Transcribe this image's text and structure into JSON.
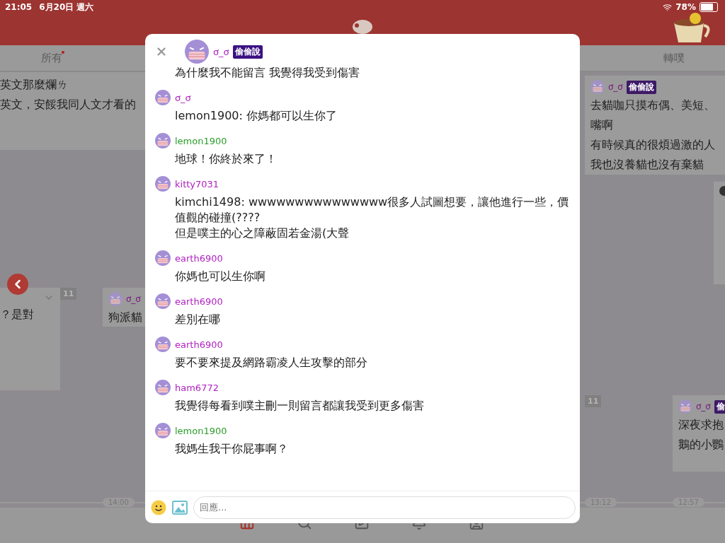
{
  "status_bar": {
    "time": "21:05",
    "date": "6月20日 週六",
    "battery": "78%"
  },
  "tabs": [
    {
      "label": "所有",
      "selected": false,
      "unread": true
    },
    {
      "label": "轉噗",
      "selected": false,
      "unread": false
    }
  ],
  "timeline": {
    "cards": [
      {
        "lines": [
          "英文那麼爛ㄌ",
          "英文，安餒我同人文才看的"
        ]
      },
      {
        "lines": [
          "？是對"
        ],
        "collapsible": true
      },
      {
        "author": "ơ_ơ",
        "lines": [
          "狗派貓"
        ]
      },
      {
        "author": "ơ_ơ",
        "badge": "偷偷說",
        "lines": [
          "去貓咖只摸布偶、美短、",
          "嘴啊",
          "有時候真的很煩過激的人",
          "我也沒養貓也沒有棄貓"
        ]
      },
      {
        "photo": true
      },
      {
        "author": "ơ_ơ",
        "badge": "偷",
        "lines": [
          "深夜求抱",
          "鵝的小鸚"
        ]
      }
    ],
    "counts": [
      "11",
      "11"
    ],
    "times": [
      "14:00",
      "13:12",
      "12:57"
    ]
  },
  "modal": {
    "post": {
      "author": "ơ_ơ",
      "color": "#b020c0",
      "badge": "偷偷說",
      "text": "為什麼我不能留言 我覺得我受到傷害"
    },
    "responses": [
      {
        "author": "ơ_ơ",
        "color": "#b020c0",
        "text": "lemon1900: 你媽都可以生你了"
      },
      {
        "author": "lemon1900",
        "color": "#2a9d2a",
        "text": "地球！你終於來了！"
      },
      {
        "author": "kitty7031",
        "color": "#b020c0",
        "text": "kimchi1498: wwwwwwwwwwwwwww很多人試圖想要，讓他進行一些，價值觀的碰撞(????\n但是噗主的心之障蔽固若金湯(大聲"
      },
      {
        "author": "earth6900",
        "color": "#b020c0",
        "text": "你媽也可以生你啊"
      },
      {
        "author": "earth6900",
        "color": "#b020c0",
        "text": "差別在哪"
      },
      {
        "author": "earth6900",
        "color": "#b020c0",
        "text": "要不要來提及網路霸凌人生攻擊的部分"
      },
      {
        "author": "ham6772",
        "color": "#b020c0",
        "text": "我覺得每看到噗主刪一則留言都讓我受到更多傷害"
      },
      {
        "author": "lemon1900",
        "color": "#2a9d2a",
        "text": "我媽生我干你屁事啊？"
      }
    ],
    "reply": {
      "placeholder": "回應..."
    }
  },
  "nav": [
    {
      "kind": "home",
      "selected": true
    },
    {
      "kind": "search",
      "selected": false
    },
    {
      "kind": "edit",
      "selected": false
    },
    {
      "kind": "bell",
      "selected": false
    },
    {
      "kind": "profile",
      "selected": false
    }
  ]
}
